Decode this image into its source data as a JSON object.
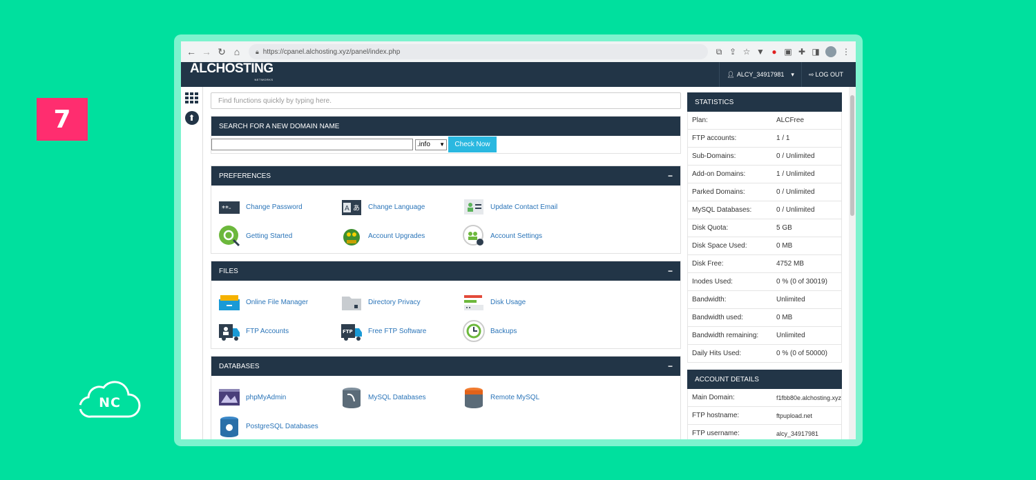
{
  "badge": {
    "number": "7",
    "color": "#ff2d6f"
  },
  "corner_logo": {
    "text": "NC"
  },
  "browser": {
    "url": "https://cpanel.alchosting.xyz/panel/index.php",
    "icons": [
      "back-icon",
      "forward-icon",
      "reload-icon",
      "home-icon",
      "lock-icon",
      "translate-icon",
      "share-icon",
      "star-icon",
      "extensions-icon",
      "sidebar-icon",
      "profile-avatar",
      "menu-icon"
    ]
  },
  "header": {
    "logo": "ALCHOSTING",
    "logo_sub": "NETWORKS",
    "user": "ALCY_34917981",
    "logout": "LOG OUT",
    "bg_color": "#223547"
  },
  "main": {
    "quick_search_placeholder": "Find functions quickly by typing here.",
    "domain_search": {
      "title": "SEARCH FOR A NEW DOMAIN NAME",
      "tld": ".info",
      "button": "Check Now",
      "button_color": "#2ab8e0"
    },
    "preferences": {
      "title": "PREFERENCES",
      "toggle": "−",
      "items": [
        "Change Password",
        "Change Language",
        "Update Contact Email",
        "Getting Started",
        "Account Upgrades",
        "Account Settings"
      ]
    },
    "files": {
      "title": "FILES",
      "toggle": "−",
      "items": [
        "Online File Manager",
        "Directory Privacy",
        "Disk Usage",
        "FTP Accounts",
        "Free FTP Software",
        "Backups"
      ]
    },
    "databases": {
      "title": "DATABASES",
      "toggle": "−",
      "items": [
        "phpMyAdmin",
        "MySQL Databases",
        "Remote MySQL",
        "PostgreSQL Databases"
      ]
    }
  },
  "statistics": {
    "title": "STATISTICS",
    "rows": [
      {
        "k": "Plan:",
        "v": "ALCFree"
      },
      {
        "k": "FTP accounts:",
        "v": "1 / 1"
      },
      {
        "k": "Sub-Domains:",
        "v": "0 / Unlimited"
      },
      {
        "k": "Add-on Domains:",
        "v": "1 / Unlimited"
      },
      {
        "k": "Parked Domains:",
        "v": "0 / Unlimited"
      },
      {
        "k": "MySQL Databases:",
        "v": "0 / Unlimited"
      },
      {
        "k": "Disk Quota:",
        "v": "5 GB"
      },
      {
        "k": "Disk Space Used:",
        "v": "0 MB"
      },
      {
        "k": "Disk Free:",
        "v": "4752 MB"
      },
      {
        "k": "Inodes Used:",
        "v": "0 % (0 of 30019)"
      },
      {
        "k": "Bandwidth:",
        "v": "Unlimited"
      },
      {
        "k": "Bandwidth used:",
        "v": "0 MB"
      },
      {
        "k": "Bandwidth remaining:",
        "v": "Unlimited"
      },
      {
        "k": "Daily Hits Used:",
        "v": "0 % (0 of 50000)"
      }
    ]
  },
  "account_details": {
    "title": "ACCOUNT DETAILS",
    "rows": [
      {
        "k": "Main Domain:",
        "v": "f1fbb80e.alchosting.xyz"
      },
      {
        "k": "FTP hostname:",
        "v": "ftpupload.net"
      },
      {
        "k": "FTP username:",
        "v": "alcy_34917981"
      }
    ]
  }
}
